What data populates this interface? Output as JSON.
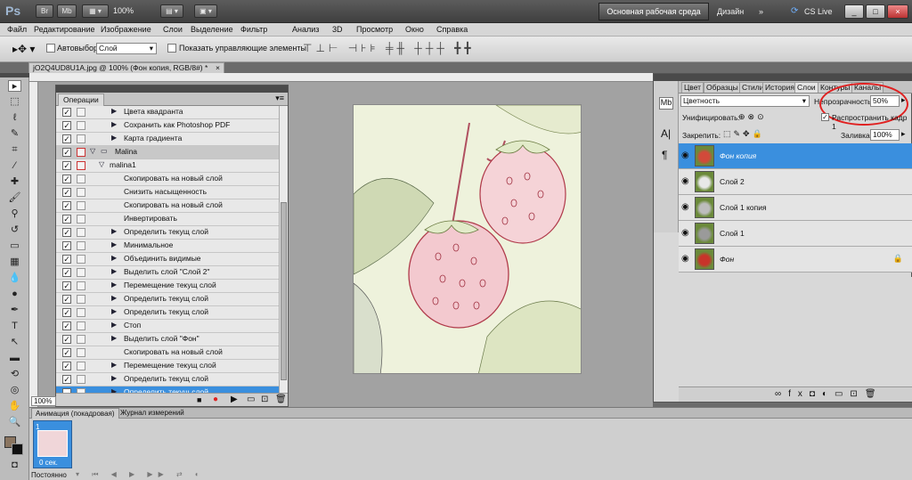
{
  "appbar": {
    "logo": "Ps",
    "buttons": [
      "Br",
      "Mb"
    ],
    "zoom": "100%",
    "workspace": "Основная рабочая среда",
    "design": "Дизайн",
    "more": "»",
    "cslive": "CS Live",
    "window_controls": [
      "_",
      "□",
      "×"
    ]
  },
  "menu": [
    "Файл",
    "Редактирование",
    "Изображение",
    "Слои",
    "Выделение",
    "Фильтр",
    "Анализ",
    "3D",
    "Просмотр",
    "Окно",
    "Справка"
  ],
  "options": {
    "autoselect_label": "Автовыбор:",
    "autoselect_value": "Слой",
    "show_controls_label": "Показать управляющие элементы"
  },
  "document": {
    "tab_title": "jO2Q4UD8U1A.jpg @ 100% (Фон копия, RGB/8#) *",
    "close": "×",
    "zoom_field": "100%"
  },
  "actions_panel": {
    "title": "Операции",
    "rows": [
      {
        "label": "Цвета квадранта",
        "type": "action",
        "checked": true
      },
      {
        "label": "Сохранить как Photoshop PDF",
        "type": "action",
        "checked": true
      },
      {
        "label": "Карта градиента",
        "type": "action",
        "checked": true
      },
      {
        "label": "Malina",
        "type": "set",
        "checked": true
      },
      {
        "label": "malina1",
        "type": "group",
        "checked": true
      },
      {
        "label": "Скопировать на новый слой",
        "type": "step",
        "checked": true
      },
      {
        "label": "Снизить насыщенность",
        "type": "step",
        "checked": true
      },
      {
        "label": "Скопировать на новый слой",
        "type": "step",
        "checked": true
      },
      {
        "label": "Инвертировать",
        "type": "step",
        "checked": true
      },
      {
        "label": "Определить текущ слой",
        "type": "expand",
        "checked": true
      },
      {
        "label": "Минимальное",
        "type": "expand",
        "checked": true
      },
      {
        "label": "Объединить видимые",
        "type": "expand",
        "checked": true
      },
      {
        "label": "Выделить слой \"Слой 2\"",
        "type": "expand",
        "checked": true
      },
      {
        "label": "Перемещение текущ слой",
        "type": "expand",
        "checked": true
      },
      {
        "label": "Определить текущ слой",
        "type": "expand",
        "checked": true
      },
      {
        "label": "Определить текущ слой",
        "type": "expand",
        "checked": true
      },
      {
        "label": "Стоп",
        "type": "expand",
        "checked": true
      },
      {
        "label": "Выделить слой \"Фон\"",
        "type": "expand",
        "checked": true
      },
      {
        "label": "Скопировать на новый слой",
        "type": "step",
        "checked": true
      },
      {
        "label": "Перемещение текущ слой",
        "type": "expand",
        "checked": true
      },
      {
        "label": "Определить текущ слой",
        "type": "expand",
        "checked": true
      },
      {
        "label": "Определить текущ слой",
        "type": "expand",
        "checked": true,
        "selected": true
      }
    ]
  },
  "layers_panel": {
    "tabs": [
      "Цвет",
      "Образцы",
      "Стили",
      "История",
      "Слои",
      "Контуры",
      "Каналы"
    ],
    "active_tab": "Слои",
    "blend_mode": "Цветность",
    "opacity_label": "Непрозрачность:",
    "opacity_value": "50%",
    "unify_label": "Унифицировать:",
    "propagate_label": "Распространить кадр 1",
    "lock_label": "Закрепить:",
    "fill_label": "Заливка:",
    "fill_value": "100%",
    "layers": [
      {
        "name": "Фон копия",
        "selected": true
      },
      {
        "name": "Слой 2",
        "selected": false
      },
      {
        "name": "Слой 1 копия",
        "selected": false
      },
      {
        "name": "Слой 1",
        "selected": false
      },
      {
        "name": "Фон",
        "selected": false,
        "locked": true
      }
    ]
  },
  "animation": {
    "tabs": [
      "Анимация (покадровая)",
      "Журнал измерений"
    ],
    "frame_time": "0 сек.",
    "loop": "Постоянно"
  },
  "colors": {
    "accent": "#3a8fde",
    "highlight_circle": "#e02020"
  }
}
